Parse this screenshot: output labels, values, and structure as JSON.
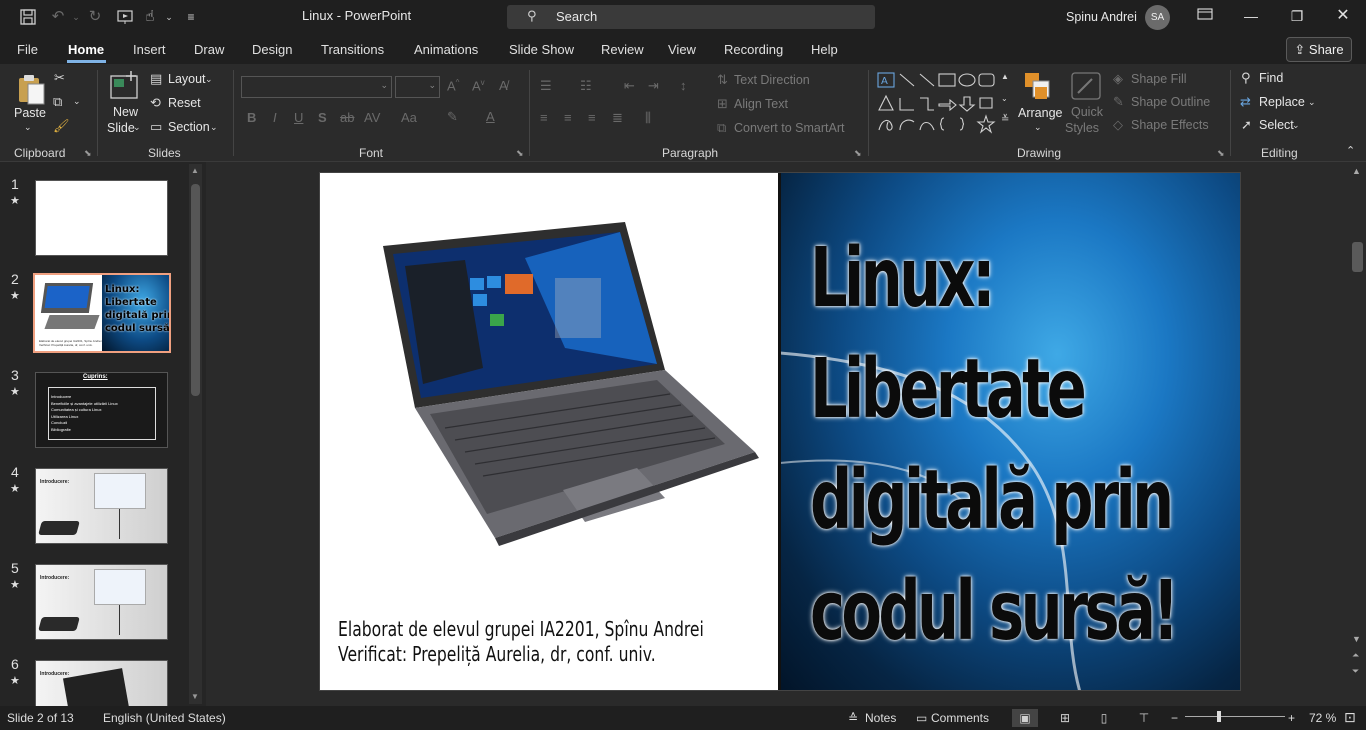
{
  "titlebar": {
    "doc_title": "Linux  -  PowerPoint",
    "search_placeholder": "Search",
    "user_name": "Spinu Andrei",
    "user_initials": "SA"
  },
  "tabs": [
    "File",
    "Home",
    "Insert",
    "Draw",
    "Design",
    "Transitions",
    "Animations",
    "Slide Show",
    "Review",
    "View",
    "Recording",
    "Help"
  ],
  "active_tab": "Home",
  "share_label": "Share",
  "ribbon": {
    "clipboard": {
      "paste": "Paste",
      "group": "Clipboard"
    },
    "slides": {
      "new_slide_1": "New",
      "new_slide_2": "Slide",
      "layout": "Layout",
      "reset": "Reset",
      "section": "Section",
      "group": "Slides"
    },
    "font": {
      "group": "Font",
      "bold": "B",
      "italic": "I",
      "underline": "U",
      "shadow": "S",
      "strike": "ab",
      "spacing": "AV",
      "case": "Aa"
    },
    "paragraph": {
      "group": "Paragraph",
      "text_direction": "Text Direction",
      "align_text": "Align Text",
      "convert_smartart": "Convert to SmartArt"
    },
    "drawing": {
      "group": "Drawing",
      "arrange": "Arrange",
      "quick_styles_1": "Quick",
      "quick_styles_2": "Styles",
      "shape_fill": "Shape Fill",
      "shape_outline": "Shape Outline",
      "shape_effects": "Shape Effects"
    },
    "editing": {
      "group": "Editing",
      "find": "Find",
      "replace": "Replace",
      "select": "Select"
    }
  },
  "thumbnails": [
    {
      "number": "1",
      "star": "★"
    },
    {
      "number": "2",
      "star": "★",
      "selected": true
    },
    {
      "number": "3",
      "star": "★",
      "title": "Cuprins:",
      "items": [
        "Introducere",
        "Beneficiile și avantajele utilizării Linux",
        "Comunitatea și cultura Linux",
        "Utilizarea Linux",
        "Concluzii",
        "Bibliografie"
      ]
    },
    {
      "number": "4",
      "star": "★",
      "title": "Introducere:"
    },
    {
      "number": "5",
      "star": "★",
      "title": "Introducere:"
    },
    {
      "number": "6",
      "star": "★",
      "title": "Introducere:"
    }
  ],
  "slide": {
    "headline_lines": [
      "Linux:",
      "Libertate",
      "digitală prin",
      "codul sursă!"
    ],
    "caption_line1": "Elaborat de elevul grupei IA2201, Spînu Andrei",
    "caption_line2": "Verificat: Prepeliță Aurelia, dr, conf. univ."
  },
  "status": {
    "slide_of": "Slide 2 of 13",
    "language": "English (United States)",
    "notes": "Notes",
    "comments": "Comments",
    "zoom": "72 %"
  },
  "colors": {
    "accent_tab": "#7fb3e6",
    "selected_thumb": "#f0a080",
    "app_bg": "#1f1f1f"
  }
}
